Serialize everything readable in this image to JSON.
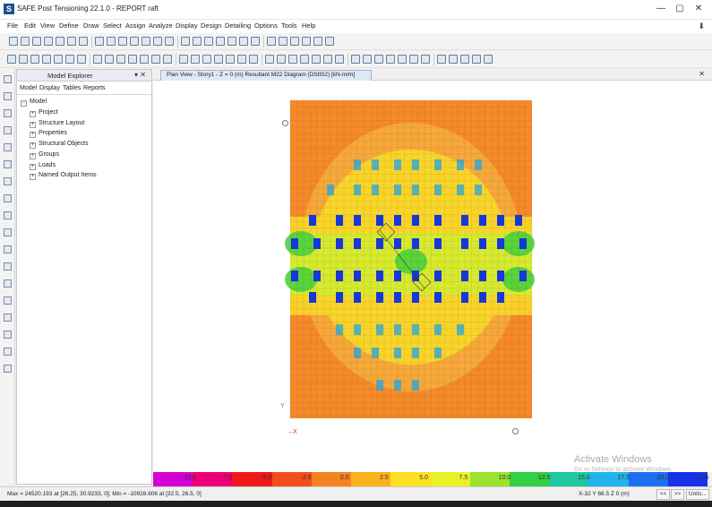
{
  "window": {
    "title": "SAFE Post Tensioning 22.1.0 - REPORT raft",
    "app_icon_letter": "S",
    "controls": {
      "minimize": "—",
      "maximize": "▢",
      "close": "✕"
    }
  },
  "menu": [
    "File",
    "Edit",
    "View",
    "Define",
    "Draw",
    "Select",
    "Assign",
    "Analyze",
    "Display",
    "Design",
    "Detailing",
    "Options",
    "Tools",
    "Help"
  ],
  "explorer": {
    "title": "Model Explorer",
    "controls": "▾ ✕",
    "tabs": [
      "Model",
      "Display",
      "Tables",
      "Reports"
    ],
    "root": "Model",
    "items": [
      "Project",
      "Structure Layout",
      "Properties",
      "Structural Objects",
      "Groups",
      "Loads",
      "Named Output Items"
    ]
  },
  "document": {
    "tab_title": "Plan View - Story1 - Z = 0 (m)   Resultant M22 Diagram   (DStlS2)  [kN-m/m]",
    "close": "✕",
    "axis_x": "X",
    "axis_y": "Y"
  },
  "watermark": {
    "title": "Activate Windows",
    "subtitle": "Go to Settings to activate Windows."
  },
  "legend": {
    "labels": [
      "-10.0",
      "-7.5",
      "-5.0",
      "-2.5",
      "0.0",
      "2.5",
      "5.0",
      "7.5",
      "10.0",
      "12.5",
      "15.0",
      "17.5",
      "20.0",
      "22.5"
    ],
    "colors": [
      "#d400d4",
      "#ee0077",
      "#f01818",
      "#f24d1e",
      "#f58220",
      "#f9b21c",
      "#fde025",
      "#eaf02a",
      "#9ae22f",
      "#31cf43",
      "#1fc6a0",
      "#22b3ea",
      "#1d6ff0",
      "#1632ea"
    ]
  },
  "status": {
    "minmax": "Max = 24520.193 at [26.25, 30.9233, 0];  Min = -10928.606 at [32.5, 26.5, 0]",
    "coords": "X-32  Y 66.5  Z 0 (m)",
    "prev": "<<",
    "next": ">>",
    "units": "Units..."
  },
  "colors": {
    "contour_orange": "#f58a2a",
    "contour_light_orange": "#f7a83a",
    "contour_yellow": "#f9d42a",
    "contour_yellow_green": "#d7ea30",
    "contour_green": "#45cf3c",
    "column_blue": "#1638d8",
    "column_cyan": "#21a6e0"
  }
}
